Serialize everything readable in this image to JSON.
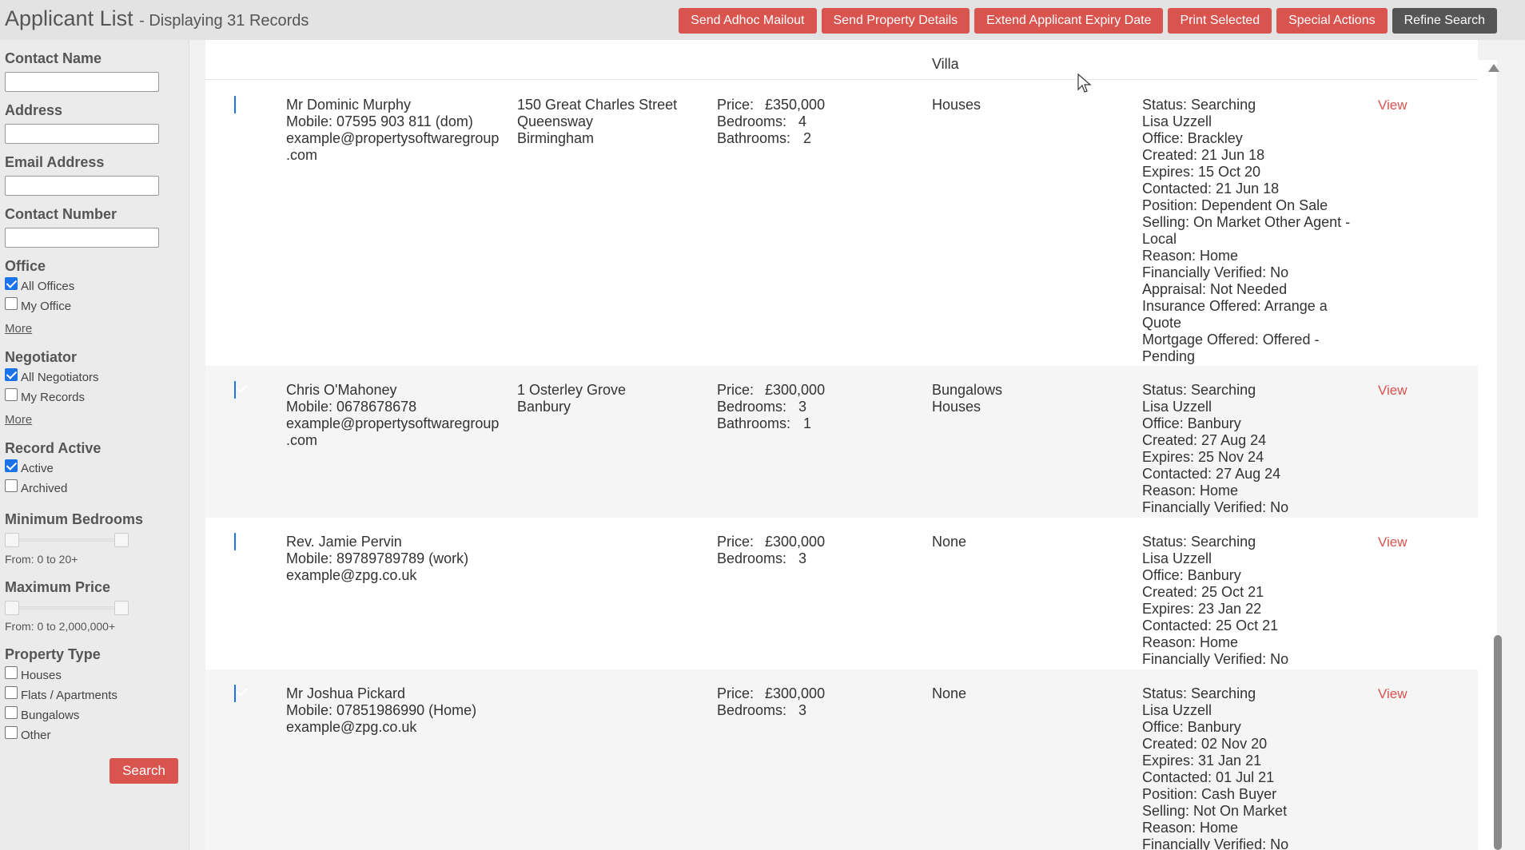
{
  "header": {
    "title": "Applicant List",
    "subtitle": "- Displaying 31 Records",
    "actions": [
      "Send Adhoc Mailout",
      "Send Property Details",
      "Extend Applicant Expiry Date",
      "Print Selected",
      "Special Actions",
      "Refine Search"
    ]
  },
  "sidebar": {
    "contact_name_label": "Contact Name",
    "address_label": "Address",
    "email_label": "Email Address",
    "contact_number_label": "Contact Number",
    "office_label": "Office",
    "office_all": "All Offices",
    "office_mine": "My Office",
    "more": "More",
    "negotiator_label": "Negotiator",
    "negotiator_all": "All Negotiators",
    "negotiator_mine": "My Records",
    "record_active_label": "Record Active",
    "active": "Active",
    "archived": "Archived",
    "min_bedrooms_label": "Minimum Bedrooms",
    "min_bedrooms_range": "From: 0 to 20+",
    "max_price_label": "Maximum Price",
    "max_price_range": "From: 0 to 2,000,000+",
    "property_type_label": "Property Type",
    "type_houses": "Houses",
    "type_flats": "Flats / Apartments",
    "type_bungalows": "Bungalows",
    "type_other": "Other",
    "search_label": "Search"
  },
  "list": {
    "top_stub_type": "Villa",
    "rows": [
      {
        "name": "Mr Dominic Murphy",
        "mobile": "Mobile: 07595 903 811 (dom)",
        "email1": "example@propertysoftwaregroup",
        "email2": ".com",
        "addr1": "150 Great Charles Street",
        "addr2": "Queensway",
        "addr3": "Birmingham",
        "price": "£350,000",
        "bedrooms": "4",
        "bathrooms": "2",
        "type1": "Houses",
        "type2": "",
        "status": [
          "Status: Searching",
          "Lisa Uzzell",
          "Office: Brackley",
          "Created: 21 Jun 18",
          "Expires: 15 Oct 20",
          "Contacted: 21 Jun 18",
          "Position: Dependent On Sale",
          "Selling: On Market Other Agent -",
          "Local",
          "Reason: Home",
          "Financially Verified: No",
          "Appraisal: Not Needed",
          "Insurance Offered: Arrange a",
          "Quote",
          "Mortgage Offered: Offered -",
          "Pending"
        ],
        "view": "View"
      },
      {
        "name": "Chris O'Mahoney",
        "mobile": "Mobile: 0678678678",
        "email1": "example@propertysoftwaregroup",
        "email2": ".com",
        "addr1": "1 Osterley Grove",
        "addr2": "Banbury",
        "addr3": "",
        "price": "£300,000",
        "bedrooms": "3",
        "bathrooms": "1",
        "type1": "Bungalows",
        "type2": "Houses",
        "status": [
          "Status: Searching",
          "Lisa Uzzell",
          "Office: Banbury",
          "Created: 27 Aug 24",
          "Expires: 25 Nov 24",
          "Contacted: 27 Aug 24",
          "Reason: Home",
          "Financially Verified: No"
        ],
        "view": "View"
      },
      {
        "name": "Rev. Jamie Pervin",
        "mobile": "Mobile: 89789789789 (work)",
        "email1": "example@zpg.co.uk",
        "email2": "",
        "addr1": "",
        "addr2": "",
        "addr3": "",
        "price": "£300,000",
        "bedrooms": "3",
        "bathrooms": "",
        "type1": "None",
        "type2": "",
        "status": [
          "Status: Searching",
          "Lisa Uzzell",
          "Office: Banbury",
          "Created: 25 Oct 21",
          "Expires: 23 Jan 22",
          "Contacted: 25 Oct 21",
          "Reason: Home",
          "Financially Verified: No"
        ],
        "view": "View"
      },
      {
        "name": "Mr Joshua Pickard",
        "mobile": "Mobile: 07851986990 (Home)",
        "email1": "example@zpg.co.uk",
        "email2": "",
        "addr1": "",
        "addr2": "",
        "addr3": "",
        "price": "£300,000",
        "bedrooms": "3",
        "bathrooms": "",
        "type1": "None",
        "type2": "",
        "status": [
          "Status: Searching",
          "Lisa Uzzell",
          "Office: Banbury",
          "Created: 02 Nov 20",
          "Expires: 31 Jan 21",
          "Contacted: 01 Jul 21",
          "Position: Cash Buyer",
          "Selling: Not On Market",
          "Reason: Home",
          "Financially Verified: No"
        ],
        "view": "View"
      }
    ],
    "labels": {
      "price": "Price:",
      "bedrooms": "Bedrooms:",
      "bathrooms": "Bathrooms:"
    }
  }
}
